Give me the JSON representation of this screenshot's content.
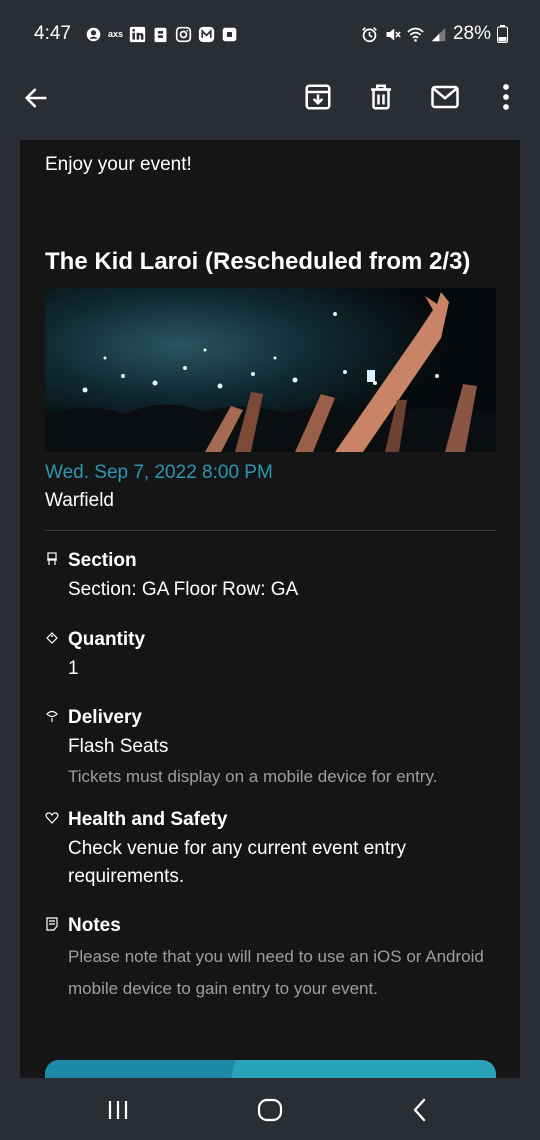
{
  "status_bar": {
    "time": "4:47",
    "left_icons": [
      "account-icon",
      "axs-icon",
      "linkedin-icon",
      "clipboard-icon",
      "instagram-icon",
      "m-icon",
      "square-icon"
    ],
    "axs_text": "axs",
    "battery": "28%",
    "right_icons": [
      "alarm-icon",
      "mute-icon",
      "wifi-icon",
      "signal-icon",
      "battery-icon"
    ]
  },
  "app_bar": {
    "actions": [
      "back-arrow-icon",
      "archive-icon",
      "delete-icon",
      "mark-unread-icon",
      "more-vert-icon"
    ]
  },
  "email": {
    "greeting": "Enjoy your event!",
    "event_title": "The Kid Laroi (Rescheduled from 2/3)",
    "image_description": "concert-crowd-image",
    "date": "Wed. Sep 7, 2022 8:00 PM",
    "venue": "Warfield",
    "details": [
      {
        "label": "Section",
        "icon": "seat-icon",
        "value": "Section: GA Floor Row: GA"
      },
      {
        "label": "Quantity",
        "icon": "ticket-tag-icon",
        "value": "1"
      },
      {
        "label": "Delivery",
        "icon": "delivery-icon",
        "value": "Flash Seats",
        "note": "Tickets must display on a mobile device for entry."
      },
      {
        "label": "Health and Safety",
        "icon": "heart-shield-icon",
        "value": "Check venue for any current event entry requirements."
      },
      {
        "label": "Notes",
        "icon": "notes-icon",
        "note": "Please note that you will need to use an iOS or Android mobile device to gain entry to your event."
      }
    ],
    "cta_colors": {
      "left": "#1c8aa6",
      "right": "#2aa3b9"
    }
  },
  "colors": {
    "background": "#2a2d33",
    "content_bg": "#151516",
    "accent": "#2a98b0",
    "muted": "#9c9ea3"
  },
  "nav_bar": {
    "buttons": [
      "recents-icon",
      "home-icon",
      "back-icon"
    ]
  }
}
